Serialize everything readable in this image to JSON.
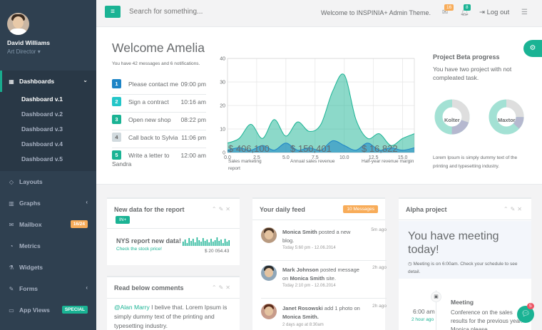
{
  "profile": {
    "name": "David Williams",
    "role": "Art Director"
  },
  "nav": {
    "dashboards": "Dashboards",
    "sub": [
      "Dashboard v.1",
      "Dashboard v.2",
      "Dashboard v.3",
      "Dashboard v.4",
      "Dashboard v.5"
    ],
    "layouts": "Layouts",
    "graphs": "Graphs",
    "mailbox": "Mailbox",
    "mailbox_badge": "16/24",
    "metrics": "Metrics",
    "widgets": "Widgets",
    "forms": "Forms",
    "appviews": "App Views",
    "appviews_badge": "SPECIAL"
  },
  "topbar": {
    "search_placeholder": "Search for something...",
    "welcome": "Welcome to INSPINIA+ Admin Theme.",
    "mail_count": "16",
    "bell_count": "8",
    "logout": "Log out"
  },
  "hero": {
    "title": "Welcome Amelia",
    "subtitle": "You have 42 messages and 6 notifications.",
    "todos": [
      {
        "num": "1",
        "text": "Please contact me",
        "time": "09:00 pm",
        "color": "#1c84c6"
      },
      {
        "num": "2",
        "text": "Sign a contract",
        "time": "10:16 am",
        "color": "#23c6c8"
      },
      {
        "num": "3",
        "text": "Open new shop",
        "time": "08:22 pm",
        "color": "#1ab394"
      },
      {
        "num": "4",
        "text": "Call back to Sylvia",
        "time": "11:06 pm",
        "color": "#d1dade"
      },
      {
        "num": "5",
        "text": "Write a letter to",
        "text2": "Sandra",
        "time": "12:00 am",
        "color": "#1ab394"
      }
    ],
    "stats": [
      {
        "value": "$ 406,100",
        "label": "Sales marketing report"
      },
      {
        "value": "$ 150,401",
        "label": "Annual sales revenue"
      },
      {
        "value": "$ 16,822",
        "label": "Half-year revenue margin"
      }
    ],
    "beta": {
      "title": "Project Beta progress",
      "subtitle": "You have two project with not compleated task.",
      "donut1": "Kolter",
      "donut2": "Maxtor",
      "lorem": "Lorem Ipsum is simply dummy text of the printing and typesetting industry."
    }
  },
  "chart_data": {
    "type": "area",
    "xlim": [
      0,
      16
    ],
    "ylim": [
      0,
      40
    ],
    "xticks": [
      "0.0",
      "2.5",
      "5.0",
      "7.5",
      "10.0",
      "12.5",
      "15.0"
    ],
    "yticks": [
      "0",
      "10",
      "20",
      "30",
      "40"
    ],
    "series": [
      {
        "color": "#1ab394",
        "x": [
          0,
          1,
          2,
          3,
          4,
          5,
          6,
          7,
          8,
          9,
          10,
          11,
          12,
          13,
          14,
          15,
          16
        ],
        "values": [
          4,
          6,
          12,
          6,
          14,
          7,
          13,
          9,
          12,
          26,
          33,
          14,
          6,
          8,
          3,
          6,
          8
        ]
      },
      {
        "color": "#1c84c6",
        "x": [
          0,
          1,
          2,
          3,
          4,
          5,
          6,
          7,
          8,
          9,
          10,
          11,
          12,
          13,
          14,
          15,
          16
        ],
        "values": [
          1,
          2,
          1,
          3,
          1,
          4,
          1,
          2,
          1,
          5,
          3,
          1,
          4,
          1,
          2,
          1,
          2
        ]
      }
    ]
  },
  "panels": {
    "report": {
      "title": "New data for the report",
      "badge": "IN+",
      "text": "NYS report new data!",
      "link": "Check the stock price!",
      "amount": "$ 20 054.43"
    },
    "feed": {
      "title": "Your daily feed",
      "badge": "10 Messages",
      "items": [
        {
          "name": "Monica Smith",
          "action": "posted a new blog.",
          "date": "Today 5:60 pm - 12.06.2014",
          "ago": "5m ago"
        },
        {
          "name": "Mark Johnson",
          "action": "posted message on",
          "target": "Monica Smith",
          "tail": "site.",
          "date": "Today 2:10 pm - 12.06.2014",
          "ago": "2h ago"
        },
        {
          "name": "Janet Rosowski",
          "action": "add 1 photo on",
          "target": "Monica Smith.",
          "date": "2 days ago at 8:30am",
          "ago": "2h ago"
        }
      ]
    },
    "comments": {
      "title": "Read below comments",
      "mention": "@Alan Marry",
      "text": "I belive that. Lorem Ipsum is simply dummy text of the printing and typesetting industry."
    },
    "alpha": {
      "title": "Alpha project",
      "meeting_title": "You have meeting today!",
      "meeting_text": "Meeting is on 6:00am. Check your schedule to see detail.",
      "time": "6:00 am",
      "ago": "2 hour ago",
      "event_title": "Meeting",
      "event_text": "Conference on the sales results for the previous year. Monica please"
    }
  },
  "colors": {
    "accent": "#1ab394",
    "sidebar": "#2f4050",
    "orange": "#f8ac59"
  },
  "chat_count": "5"
}
